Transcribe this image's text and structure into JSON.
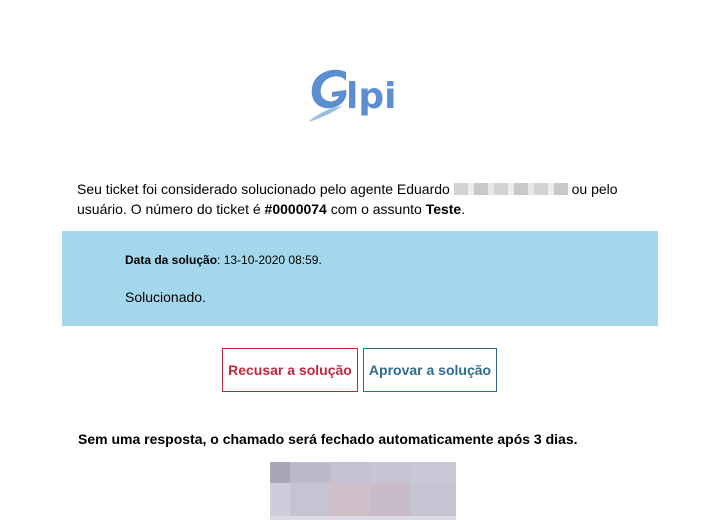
{
  "logo": {
    "text": "glpi",
    "brand_color": "#5b8fd0"
  },
  "intro": {
    "before_name": "Seu ticket foi considerado solucionado pelo agente Eduardo",
    "after_name": "ou pelo usuário. O número do ticket é",
    "ticket_number": "#0000074",
    "subject_prefix": "com o assunto",
    "subject": "Teste",
    "end": "."
  },
  "solution": {
    "date_label": "Data da solução",
    "date_value": ": 13-10-2020 08:59.",
    "text": "Solucionado.",
    "background": "#a3d7ec"
  },
  "actions": {
    "refuse_label": "Recusar a solução",
    "approve_label": "Aprovar a solução",
    "refuse_color": "#c3273d",
    "approve_color": "#2f6a8f"
  },
  "footer": {
    "auto_close_text": "Sem uma resposta, o chamado será fechado automaticamente após 3 dias."
  }
}
